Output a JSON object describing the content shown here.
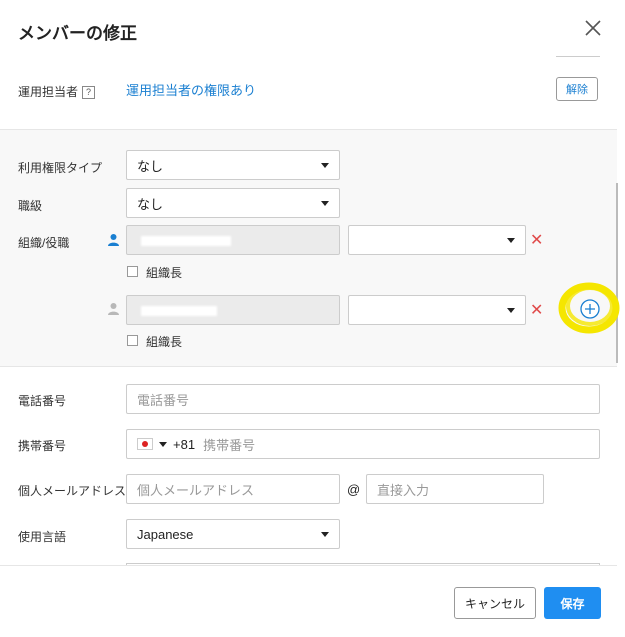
{
  "dialog": {
    "title": "メンバーの修正",
    "close_icon": "close-icon"
  },
  "admin": {
    "label": "運用担当者",
    "help": "?",
    "link_text": "運用担当者の権限あり",
    "release_button": "解除"
  },
  "permissions": {
    "type_label": "利用権限タイプ",
    "type_value": "なし",
    "grade_label": "職級",
    "grade_value": "なし",
    "org_label": "組織/役職",
    "org_rows": [
      {
        "leader_label": "組織長",
        "status_color": "#1a7fd1"
      },
      {
        "leader_label": "組織長",
        "status_color": "#b8b8b8"
      }
    ],
    "remove_icon": "✕",
    "add_icon": "plus-circle-icon"
  },
  "contact": {
    "phone_label": "電話番号",
    "phone_placeholder": "電話番号",
    "mobile_label": "携帯番号",
    "country_code": "+81",
    "mobile_placeholder": "携帯番号",
    "email_label": "個人メールアドレス",
    "email_placeholder": "個人メールアドレス",
    "at": "@",
    "domain_placeholder": "直接入力",
    "language_label": "使用言語",
    "language_value": "Japanese"
  },
  "footer": {
    "cancel_label": "キャンセル",
    "save_label": "保存"
  },
  "colors": {
    "accent": "#1f8ef1",
    "highlight": "#f5e600",
    "danger": "#e04a4a"
  }
}
